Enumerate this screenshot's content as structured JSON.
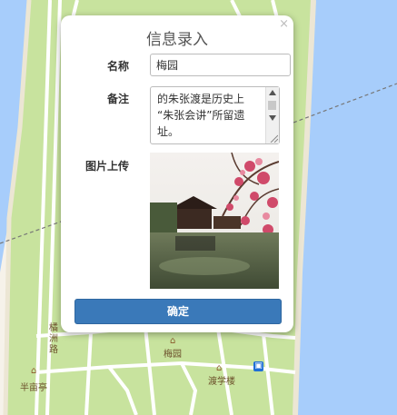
{
  "dialog": {
    "title": "信息录入",
    "close_icon": "×",
    "name_label": "名称",
    "name_value": "梅园",
    "remark_label": "备注",
    "remark_text": "的朱张渡是历史上\n“朱张会讲”所留遗\n址。",
    "image_label": "图片上传",
    "confirm_label": "确定"
  },
  "map": {
    "labels": {
      "road_vertical": "橘洲路",
      "poi_main": "梅园",
      "poi_left": "半亩亭",
      "poi_right": "渡学楼"
    },
    "colors": {
      "water": "#a7cdfb",
      "land": "#f6f2ea",
      "park": "#c8e39e",
      "road": "#ffffff",
      "accent": "#3a79b9"
    }
  }
}
